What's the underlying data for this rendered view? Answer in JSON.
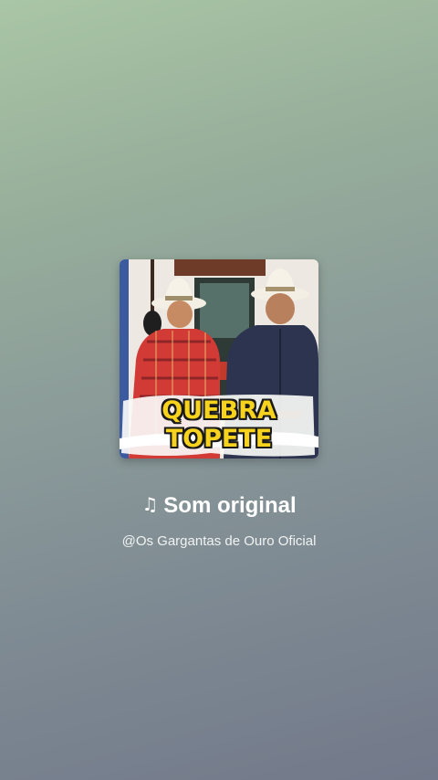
{
  "sound": {
    "title": "Som original",
    "artist": "@Os Gargantas de Ouro Oficial",
    "note_icon": "♫"
  },
  "cover": {
    "line1": "QUEBRA",
    "line2": "TOPETE",
    "text_color": "#f7d31e"
  },
  "colors": {
    "background_top": "#a9c6a5",
    "background_bottom": "#72798a"
  }
}
